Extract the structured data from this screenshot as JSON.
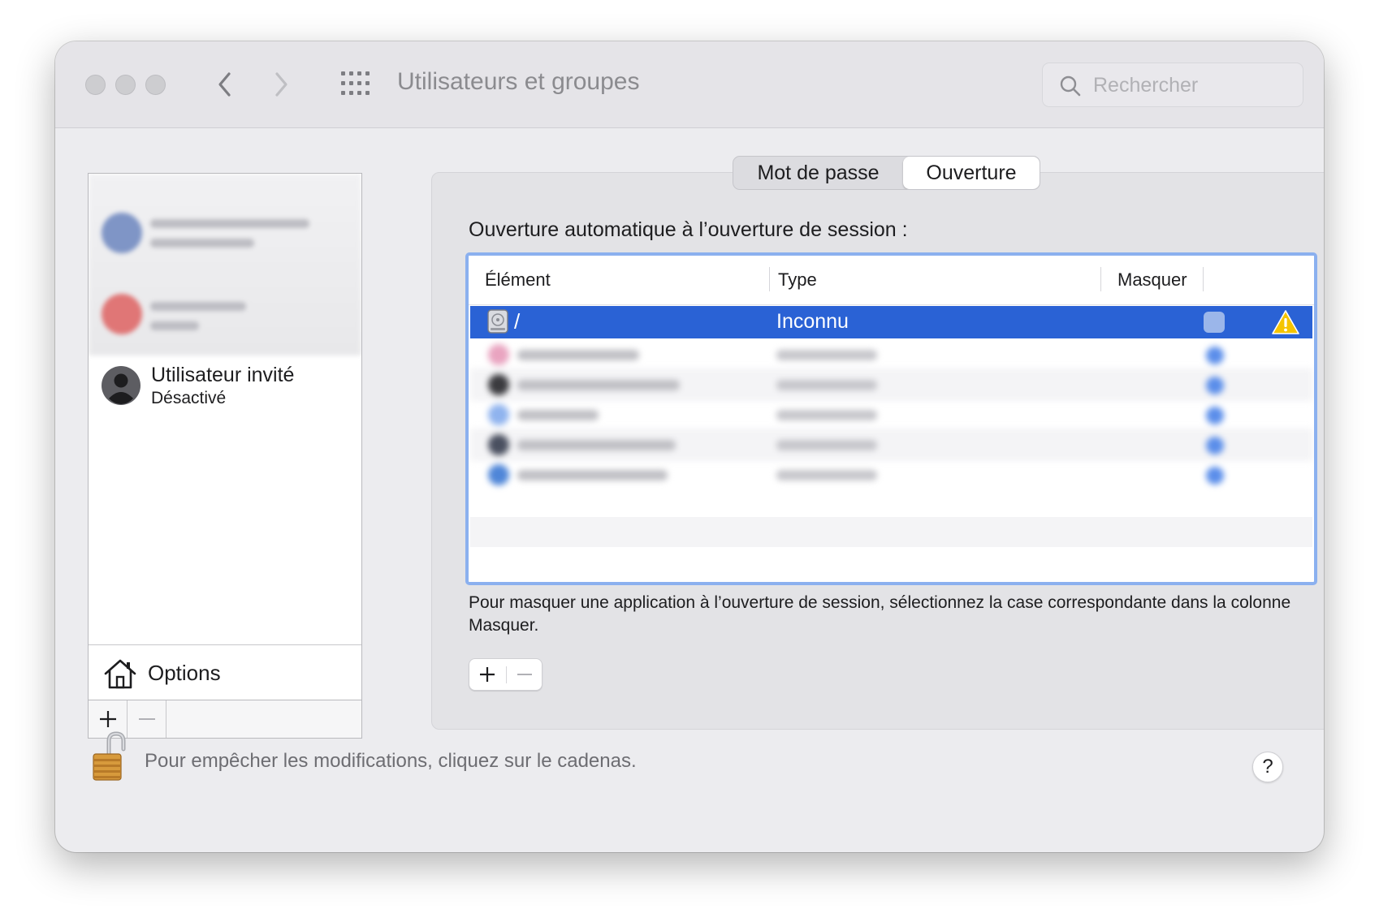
{
  "window": {
    "title": "Utilisateurs et groupes"
  },
  "search": {
    "placeholder": "Rechercher"
  },
  "sidebar": {
    "guest_user": {
      "name": "Utilisateur invité",
      "status": "Désactivé"
    },
    "options_label": "Options"
  },
  "tabs": [
    {
      "label": "Mot de passe",
      "active": false
    },
    {
      "label": "Ouverture",
      "active": true
    }
  ],
  "login_items": {
    "section_label": "Ouverture automatique à l’ouverture de session :",
    "columns": [
      "Élément",
      "Type",
      "Masquer"
    ],
    "rows": [
      {
        "name": "/",
        "type": "Inconnu",
        "hide": false,
        "warning": true,
        "selected": true
      }
    ],
    "help_text": "Pour masquer une application à l’ouverture de session, sélectionnez la case correspondante dans la colonne Masquer."
  },
  "footer": {
    "lock_text": "Pour empêcher les modifications, cliquez sur le cadenas.",
    "help_label": "?"
  },
  "colors": {
    "selection": "#2a62d5",
    "table_focus_ring": "#8bb0ef",
    "warning": "#f5c400"
  },
  "icons": [
    "back-icon",
    "forward-icon",
    "grid-icon",
    "search-icon",
    "user-avatar-icon",
    "house-icon",
    "plus-icon",
    "minus-icon",
    "disk-icon",
    "warning-icon",
    "lock-icon"
  ]
}
